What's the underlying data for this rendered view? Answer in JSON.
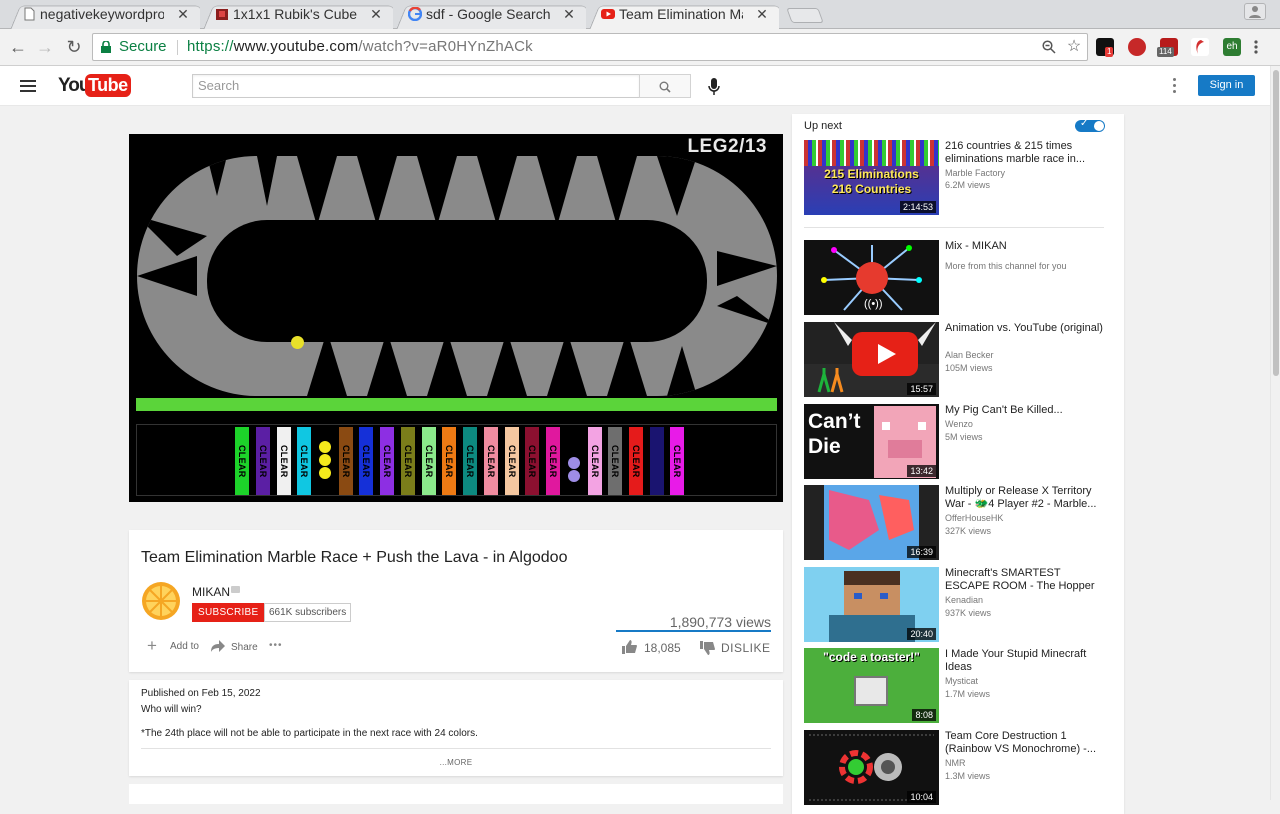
{
  "browser": {
    "tabs": [
      {
        "title": "negativekeywordpro",
        "favicon": "page-icon"
      },
      {
        "title": "1x1x1 Rubik's Cube",
        "favicon": "cube-icon"
      },
      {
        "title": "sdf - Google Search",
        "favicon": "google-icon"
      },
      {
        "title": "Team Elimination Ma",
        "favicon": "youtube-icon",
        "active": true
      }
    ],
    "address": {
      "secure_label": "Secure",
      "scheme": "https://",
      "host": "www.youtube.com",
      "path": "/watch?v=aR0HYnZhACk"
    },
    "ext_badges": {
      "badge1": "1",
      "badge2": "114"
    },
    "accent_green": "#0b8043"
  },
  "youtube": {
    "logo_you": "You",
    "logo_tube": "Tube",
    "search_placeholder": "Search",
    "signin_label": "Sign in",
    "brand_red": "#e62117",
    "brand_blue": "#167ac6"
  },
  "video": {
    "overlay_text": "LEG2/13",
    "lane_label": "CLEAR",
    "title": "Team Elimination Marble Race + Push the Lava - in Algodoo",
    "channel": "MIKAN",
    "subscribe_label": "SUBSCRIBE",
    "subscribers": "661K subscribers",
    "views": "1,890,773 views",
    "add_to_label": "Add to",
    "share_label": "Share",
    "more_dots": "•••",
    "likes": "18,085",
    "dislike_label": "DISLIKE"
  },
  "description": {
    "published": "Published on Feb 15, 2022",
    "line1": "Who will win?",
    "line2": "*The 24th place will not be able to participate in the next race with 24 colors.",
    "more_label": "...MORE"
  },
  "sidebar": {
    "up_next_label": "Up next",
    "autoplay_check": "✓",
    "items": [
      {
        "title": "216 countries & 215 times eliminations marble race in...",
        "channel": "Marble Factory",
        "meta": "6.2M views",
        "duration": "2:14:53",
        "thumb_text1": "215 Eliminations",
        "thumb_text2": "216 Countries"
      },
      {
        "title": "Mix - MIKAN",
        "channel": "",
        "meta": "More from this channel for you",
        "duration": ""
      },
      {
        "title": "Animation vs. YouTube (original)",
        "channel": "Alan Becker",
        "meta": "105M views",
        "duration": "15:57"
      },
      {
        "title": "My Pig Can't Be Killed...",
        "channel": "Wenzo",
        "meta": "5M views",
        "duration": "13:42",
        "thumb_text1": "Can’t",
        "thumb_text2": "Die"
      },
      {
        "title": "Multiply or Release X Territory War - 🐲4 Player #2 - Marble...",
        "channel": "OfferHouseHK",
        "meta": "327K views",
        "duration": "16:39"
      },
      {
        "title": "Minecraft's SMARTEST ESCAPE ROOM - The Hopper",
        "channel": "Kenadian",
        "meta": "937K views",
        "duration": "20:40"
      },
      {
        "title": "I Made Your Stupid Minecraft Ideas",
        "channel": "Mysticat",
        "meta": "1.7M views",
        "duration": "8:08",
        "thumb_text1": "\"code a toaster!\""
      },
      {
        "title": "Team Core Destruction 1 (Rainbow VS Monochrome) -...",
        "channel": "NMR",
        "meta": "1.3M views",
        "duration": "10:04"
      }
    ]
  }
}
